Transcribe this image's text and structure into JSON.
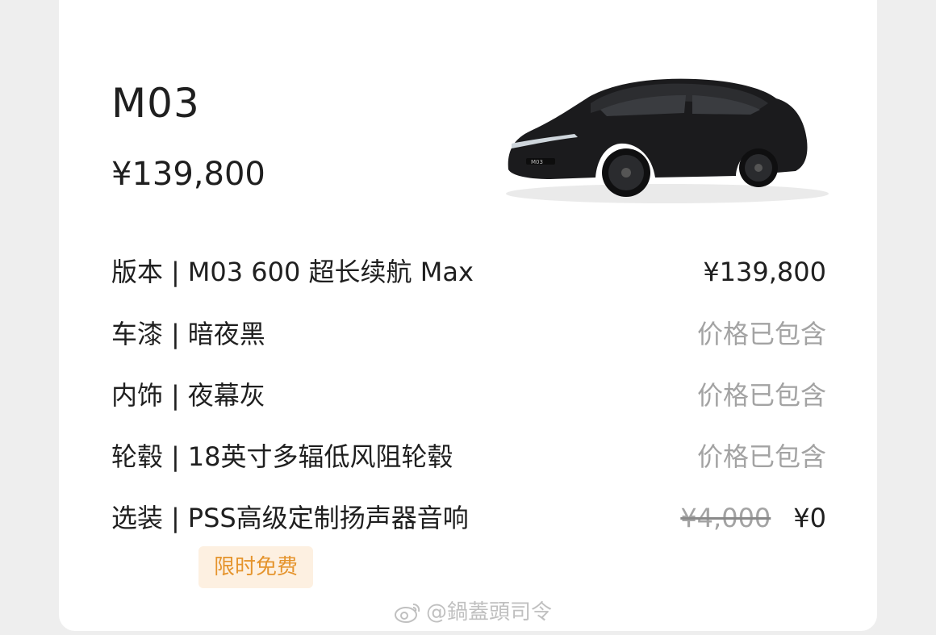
{
  "car": {
    "model": "M03",
    "price": "¥139,800",
    "image_alt": "black sedan",
    "front_badge": "M03"
  },
  "config": {
    "separator": "|",
    "rows": [
      {
        "label": "版本",
        "value": "M03 600 超长续航 Max",
        "price": "¥139,800"
      },
      {
        "label": "车漆",
        "value": "暗夜黑",
        "price": "价格已包含"
      },
      {
        "label": "内饰",
        "value": "夜幕灰",
        "price": "价格已包含"
      },
      {
        "label": "轮毂",
        "value": "18英寸多辐低风阻轮毂",
        "price": "价格已包含"
      },
      {
        "label": "选装",
        "value": "PSS高级定制扬声器音响",
        "original_price": "¥4,000",
        "price": "¥0"
      }
    ],
    "promo_badge": "限时免费"
  },
  "watermark": {
    "icon": "weibo-icon",
    "text": "@鍋蓋頭司令"
  },
  "colors": {
    "background": "#eeeeee",
    "card": "#ffffff",
    "text_primary": "#1f1f1f",
    "text_muted": "#a3a3a3",
    "badge_bg": "#fdf0e1",
    "badge_text": "#e5942d"
  }
}
